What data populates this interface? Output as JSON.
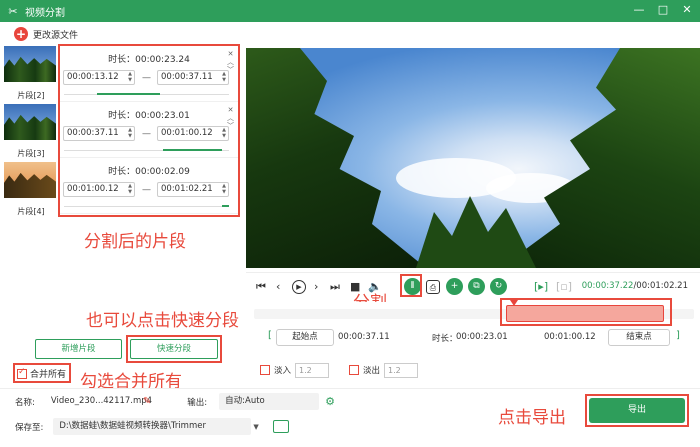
{
  "window": {
    "title": "视频分割",
    "minimize": "—",
    "restore": "□",
    "close": "✕"
  },
  "toolbar": {
    "add_source_label": "更改源文件"
  },
  "clips": [
    {
      "label": "片段[2]"
    },
    {
      "label": "片段[3]"
    },
    {
      "label": "片段[4]"
    }
  ],
  "segments": [
    {
      "duration": "时长：00:00:23.24",
      "start": "00:00:13.12",
      "end": "00:00:37.11",
      "progress_start": 0.2,
      "progress_end": 0.58
    },
    {
      "duration": "时长：00:00:23.01",
      "start": "00:00:37.11",
      "end": "00:01:00.12",
      "progress_start": 0.6,
      "progress_end": 0.96
    },
    {
      "duration": "时长：00:00:02.09",
      "start": "00:01:00.12",
      "end": "00:01:02.21",
      "progress_start": 0.96,
      "progress_end": 1.0
    }
  ],
  "segment_controls": {
    "close": "✕",
    "up": "︿",
    "down": "﹀",
    "dash": "—"
  },
  "annotations": {
    "segments_after_split": "分割后的片段",
    "split": "分割",
    "quick_split_hint": "也可以点击快速分段",
    "merge_hint": "勾选合并所有",
    "export_hint": "点击导出"
  },
  "player": {
    "current_time": "00:00:37.22",
    "total_time": "/00:01:02.21",
    "icons": [
      "skip-start-icon",
      "prev-icon",
      "play-icon",
      "next-icon",
      "skip-end-icon",
      "stop-icon",
      "volume-icon",
      "split-icon",
      "snapshot-icon",
      "add-icon",
      "copy-icon",
      "reset-icon",
      "mark-in-icon",
      "mark-out-icon"
    ]
  },
  "range": {
    "start_bracket": "[",
    "start_label": "起始点",
    "start_value": "00:00:37.11",
    "duration_label": "时长：",
    "duration_value": "00:00:23.01",
    "end_value": "00:01:00.12",
    "end_bracket": "]",
    "end_label": "结束点"
  },
  "fade": {
    "fade_in_label": "淡入",
    "fade_in_value": "1.2",
    "fade_out_label": "淡出",
    "fade_out_value": "1.2"
  },
  "buttons": {
    "new_segment": "新增片段",
    "quick_split": "快速分段",
    "merge_all": "合并所有",
    "export": "导出"
  },
  "output": {
    "name_label": "名称:",
    "name_value": "Video_230...42117.mp4",
    "output_label": "输出:",
    "output_value": "自动:Auto",
    "save_label": "保存至:",
    "save_path": "D:\\数据蛙\\数据蛙视频转换器\\Trimmer"
  },
  "colors": {
    "accent": "#2e9e5b",
    "annotation": "#e84a3c"
  }
}
